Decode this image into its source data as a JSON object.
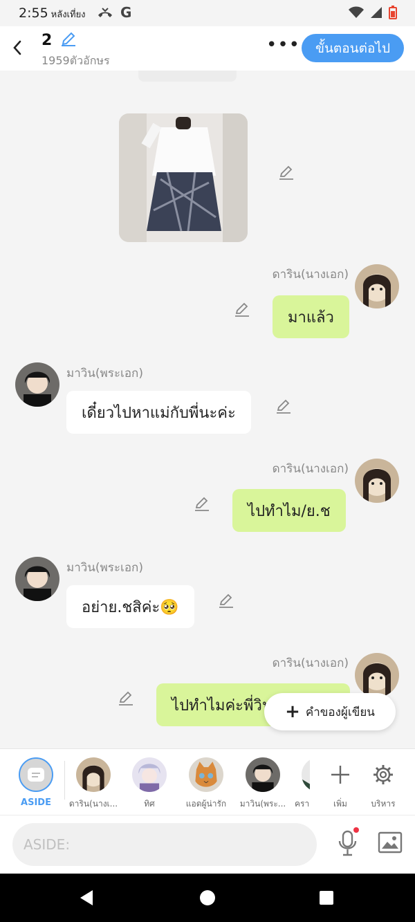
{
  "status": {
    "time": "2:55",
    "period": "หลังเที่ยง",
    "g_letter": "G"
  },
  "header": {
    "episode_number": "2",
    "char_count": "1959ตัวอักษร",
    "next_button": "ขั้นตอนต่อไป"
  },
  "chat": {
    "messages": [
      {
        "side": "right",
        "speaker": "ดาริน(นางเอก)",
        "text": "มาแล้ว"
      },
      {
        "side": "left",
        "speaker": "มาวิน(พระเอก)",
        "text": "เดี๋ยวไปหาแม่กับพี่นะค่ะ"
      },
      {
        "side": "right",
        "speaker": "ดาริน(นางเอก)",
        "text": "ไปทำไม/ย.ช"
      },
      {
        "side": "left",
        "speaker": "มาวิน(พระเอก)",
        "text": "อย่าย.ชสิค่ะ🥺"
      },
      {
        "side": "right",
        "speaker": "ดาริน(นางเอก)",
        "text": "ไปทำไมค่ะพี่วิน"
      }
    ],
    "writer_button": "คำของผู้เขียน"
  },
  "characters": {
    "aside": "ASIDE",
    "items": [
      {
        "label": "ดาริน(นางเ..."
      },
      {
        "label": "ทิศ"
      },
      {
        "label": "แอดผู้น่ารัก"
      },
      {
        "label": "มาวิน(พระ..."
      },
      {
        "label": "ครา"
      }
    ],
    "add_label": "เพิ่ม",
    "manage_label": "บริหาร"
  },
  "input": {
    "placeholder": "ASIDE:"
  },
  "colors": {
    "accent": "#4a9cf3",
    "bubble_green": "#d9f59a",
    "bubble_white": "#ffffff",
    "background": "#f4f4f4"
  }
}
